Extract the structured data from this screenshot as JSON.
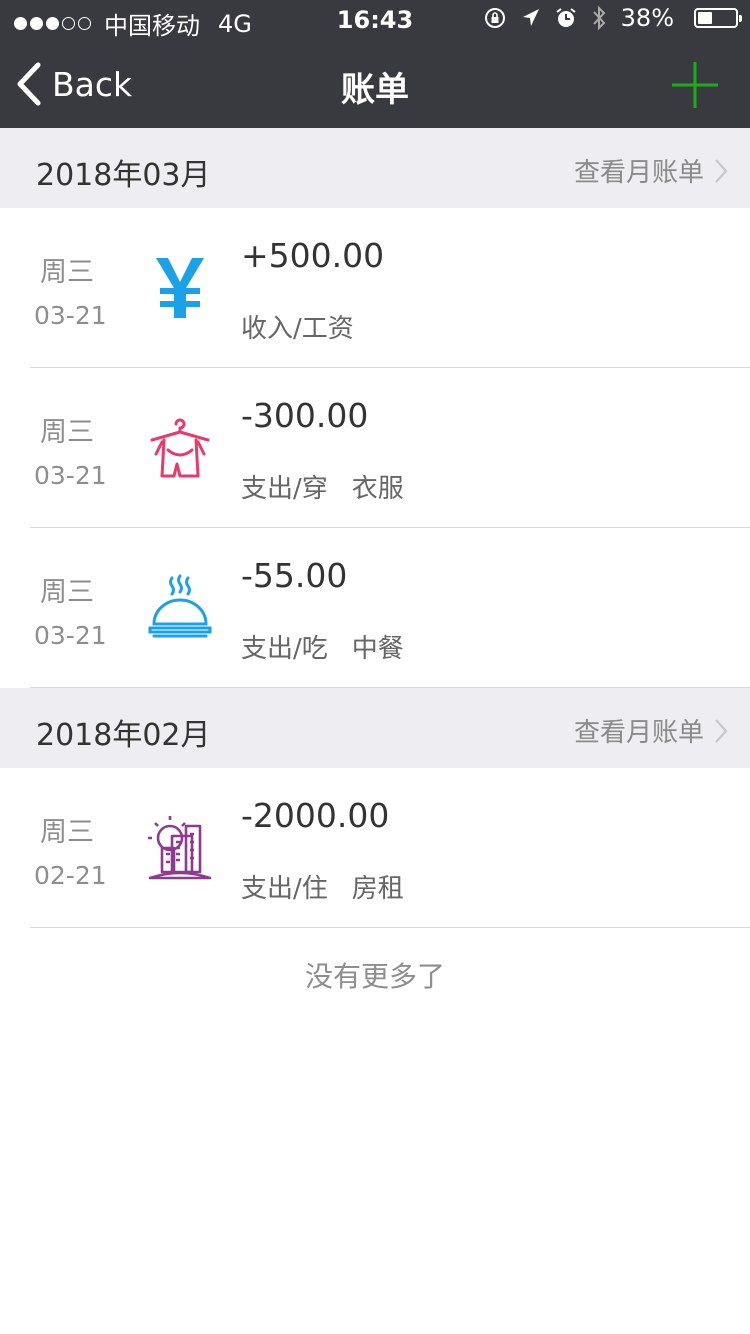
{
  "status_bar": {
    "carrier": "中国移动",
    "network": "4G",
    "time": "16:43",
    "battery": "38%",
    "signal_dots_filled": 3,
    "signal_dots_total": 5
  },
  "nav": {
    "back_label": "Back",
    "title": "账单",
    "add_icon": "plus-icon",
    "accent_color": "#1aad19"
  },
  "sections": [
    {
      "month": "2018年03月",
      "link_label": "查看月账单",
      "items": [
        {
          "weekday": "周三",
          "date": "03-21",
          "amount": "+500.00",
          "category": "收入/工资",
          "note": "",
          "icon": "yen-icon",
          "color": "#1aa1e8"
        },
        {
          "weekday": "周三",
          "date": "03-21",
          "amount": "-300.00",
          "category": "支出/穿",
          "note": "衣服",
          "icon": "clothes-icon",
          "color": "#ea3a6b"
        },
        {
          "weekday": "周三",
          "date": "03-21",
          "amount": "-55.00",
          "category": "支出/吃",
          "note": "中餐",
          "icon": "food-cloche-icon",
          "color": "#1aa1e8"
        }
      ]
    },
    {
      "month": "2018年02月",
      "link_label": "查看月账单",
      "items": [
        {
          "weekday": "周三",
          "date": "02-21",
          "amount": "-2000.00",
          "category": "支出/住",
          "note": "房租",
          "icon": "building-icon",
          "color": "#8e3a8e"
        }
      ]
    }
  ],
  "footer": {
    "no_more": "没有更多了"
  }
}
